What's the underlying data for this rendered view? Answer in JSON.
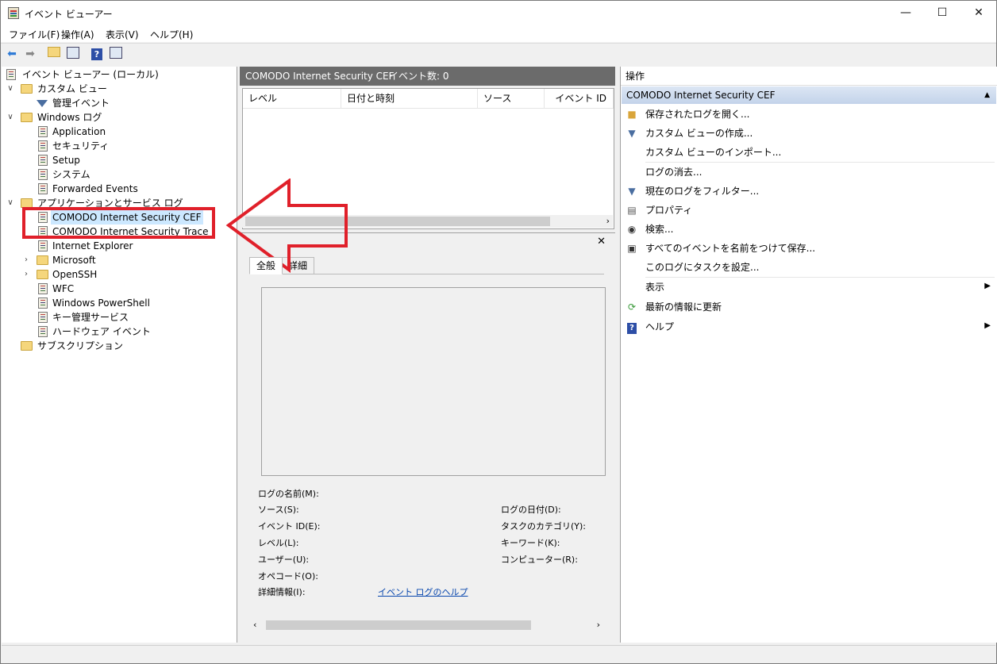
{
  "window": {
    "title": "イベント ビューアー"
  },
  "menubar": {
    "items": [
      "ファイル(F)",
      "操作(A)",
      "表示(V)",
      "ヘルプ(H)"
    ]
  },
  "tree": {
    "root": "イベント ビューアー (ローカル)",
    "custom_view": "カスタム ビュー",
    "admin_events": "管理イベント",
    "windows_logs": "Windows ログ",
    "win_items": [
      "Application",
      "セキュリティ",
      "Setup",
      "システム",
      "Forwarded Events"
    ],
    "app_service_logs": "アプリケーションとサービス ログ",
    "app_items": [
      "COMODO Internet Security CEF",
      "COMODO Internet Security Trace",
      "Internet Explorer",
      "Microsoft",
      "OpenSSH",
      "WFC",
      "Windows PowerShell",
      "キー管理サービス",
      "ハードウェア イベント"
    ],
    "subscriptions": "サブスクリプション"
  },
  "middle": {
    "header_title": "COMODO Internet Security CEF",
    "header_count": "イベント数: 0",
    "columns": [
      "レベル",
      "日付と時刻",
      "ソース",
      "イベント ID"
    ],
    "tabs": [
      "全般",
      "詳細"
    ],
    "fields_left": [
      "ログの名前(M):",
      "ソース(S):",
      "イベント ID(E):",
      "レベル(L):",
      "ユーザー(U):",
      "オペコード(O):",
      "詳細情報(I):"
    ],
    "fields_right": [
      "ログの日付(D):",
      "タスクのカテゴリ(Y):",
      "キーワード(K):",
      "コンピューター(R):"
    ],
    "help_link": "イベント ログのヘルプ"
  },
  "actions": {
    "title": "操作",
    "section": "COMODO Internet Security CEF",
    "items": [
      "保存されたログを開く...",
      "カスタム ビューの作成...",
      "カスタム ビューのインポート...",
      "ログの消去...",
      "現在のログをフィルター...",
      "プロパティ",
      "検索...",
      "すべてのイベントを名前をつけて保存...",
      "このログにタスクを設定...",
      "表示",
      "最新の情報に更新",
      "ヘルプ"
    ]
  },
  "colors": {
    "annotation": "#e0202a",
    "header_bg": "#6b6b6b",
    "selection": "#cce8ff"
  },
  "icons": [
    "back-arrow-icon",
    "forward-arrow-icon",
    "folder-up-icon",
    "show-hide-tree-icon",
    "help-icon",
    "show-hide-action-icon"
  ]
}
